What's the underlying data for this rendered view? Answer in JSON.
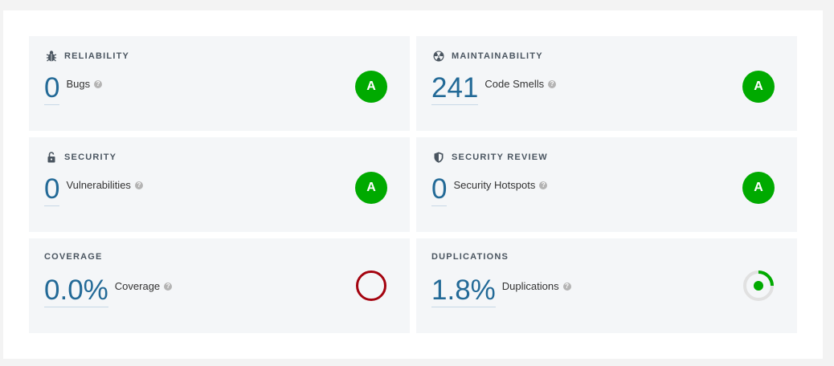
{
  "colors": {
    "rating_a": "#00aa00",
    "value_blue": "#236a97",
    "coverage_ring": "#a4030f",
    "duplications_green": "#00aa00"
  },
  "cards": {
    "reliability": {
      "title": "RELIABILITY",
      "icon": "bug-icon",
      "value": "0",
      "label": "Bugs",
      "rating": "A"
    },
    "maintainability": {
      "title": "MAINTAINABILITY",
      "icon": "radiation-icon",
      "value": "241",
      "label": "Code Smells",
      "rating": "A"
    },
    "security": {
      "title": "SECURITY",
      "icon": "unlock-icon",
      "value": "0",
      "label": "Vulnerabilities",
      "rating": "A"
    },
    "security_review": {
      "title": "SECURITY REVIEW",
      "icon": "shield-icon",
      "value": "0",
      "label": "Security Hotspots",
      "rating": "A"
    },
    "coverage": {
      "title": "COVERAGE",
      "value": "0.0%",
      "label": "Coverage",
      "indicator": "coverage-ring-icon"
    },
    "duplications": {
      "title": "DUPLICATIONS",
      "value": "1.8%",
      "label": "Duplications",
      "indicator": "duplications-donut-icon"
    }
  },
  "help_glyph": "?"
}
